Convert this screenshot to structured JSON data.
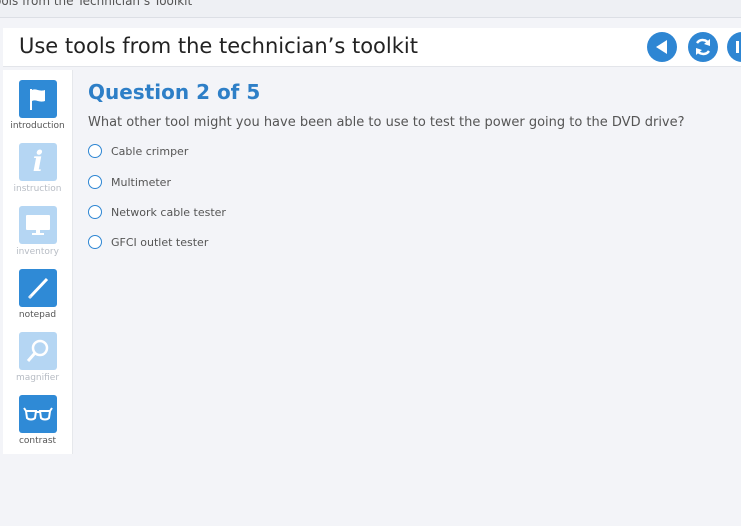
{
  "window": {
    "title": "ools from the Technician’s Toolkit"
  },
  "header": {
    "title": "Use tools from the technician’s toolkit",
    "buttons": [
      "back",
      "replay",
      "next"
    ]
  },
  "sidebar": {
    "tools": [
      {
        "label": "introduction",
        "icon": "flag-icon",
        "enabled": true
      },
      {
        "label": "instruction",
        "icon": "info-icon",
        "enabled": false
      },
      {
        "label": "inventory",
        "icon": "monitor-icon",
        "enabled": false
      },
      {
        "label": "notepad",
        "icon": "pencil-icon",
        "enabled": true
      },
      {
        "label": "magnifier",
        "icon": "magnifier-icon",
        "enabled": false
      },
      {
        "label": "contrast",
        "icon": "glasses-icon",
        "enabled": true
      }
    ]
  },
  "question": {
    "title": "Question 2 of 5",
    "text": "What other tool might you have been able to use to test the power going to the DVD drive?",
    "options": [
      "Cable crimper",
      "Multimeter",
      "Network cable tester",
      "GFCI outlet tester"
    ]
  },
  "colors": {
    "accent": "#2e86d3",
    "disabled": "#b5d6f3",
    "title": "#2e7fc7"
  }
}
